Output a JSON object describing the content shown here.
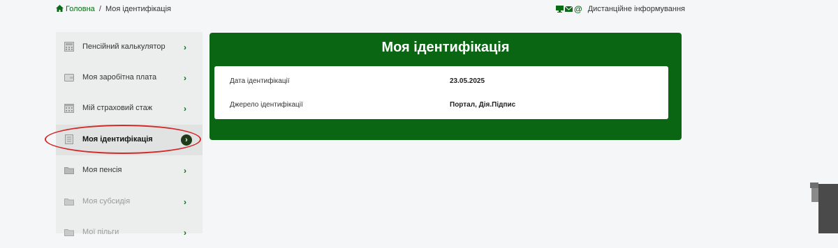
{
  "breadcrumb": {
    "home_label": "Головна",
    "separator": "/",
    "current": "Моя ідентифікація"
  },
  "top_links": {
    "remote_info_label": "Дистанційне інформування"
  },
  "sidebar": {
    "items": [
      {
        "label": "Пенсійний калькулятор",
        "icon": "calculator-icon",
        "chevron": "›"
      },
      {
        "label": "Моя заробітна плата",
        "icon": "wallet-icon",
        "chevron": "›"
      },
      {
        "label": "Мій страховий стаж",
        "icon": "calendar-icon",
        "chevron": "›"
      },
      {
        "label": "Моя ідентифікація",
        "icon": "document-icon",
        "chevron": "›",
        "active": true
      },
      {
        "label": "Моя пенсія",
        "icon": "folder-icon",
        "chevron": "›"
      },
      {
        "label": "Моя субсидія",
        "icon": "folder-icon",
        "chevron": "›"
      },
      {
        "label": "Мої пільги",
        "icon": "folder-icon",
        "chevron": "›"
      }
    ]
  },
  "main": {
    "title": "Моя ідентифікація",
    "rows": [
      {
        "label": "Дата ідентифікації",
        "value": "23.05.2025"
      },
      {
        "label": "Джерело ідентифікації",
        "value": "Портал, Дія.Підпис"
      }
    ]
  },
  "colors": {
    "accent_green": "#0b6613",
    "highlight_ellipse": "#d42a2a"
  }
}
